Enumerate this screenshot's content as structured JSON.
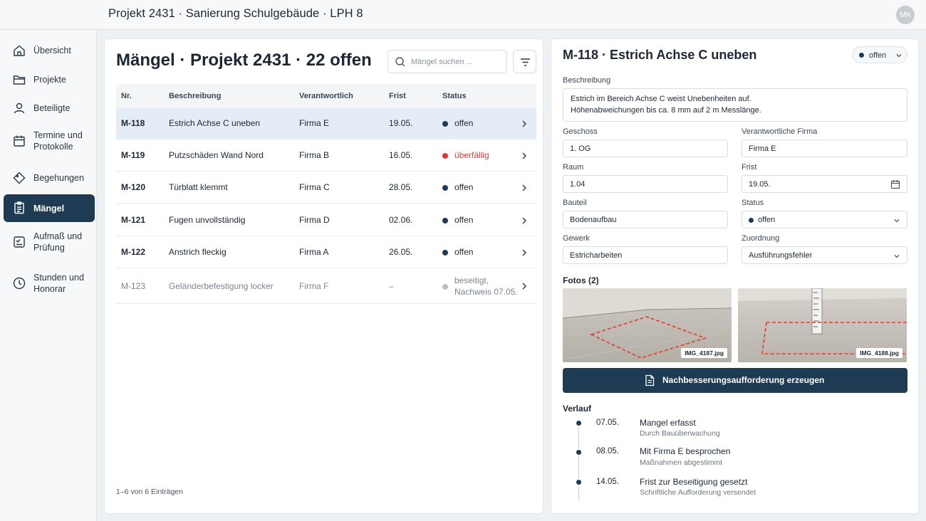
{
  "header": {
    "title": "Projekt 2431 · Sanierung Schulgebäude · LPH 8",
    "avatar_initials": "MK"
  },
  "sidebar": {
    "items": [
      {
        "label": "Übersicht",
        "icon": "home-icon"
      },
      {
        "label": "Projekte",
        "icon": "folder-icon"
      },
      {
        "label": "Beteiligte",
        "icon": "user-icon"
      },
      {
        "label": "Termine und Protokolle",
        "icon": "calendar-icon"
      },
      {
        "label": "Begehungen",
        "icon": "diamond-icon"
      },
      {
        "label": "Mängel",
        "icon": "clipboard-icon",
        "active": true
      },
      {
        "label": "Aufmaß und Prüfung",
        "icon": "checklist-icon"
      },
      {
        "label": "Stunden und Honorar",
        "icon": "clock-icon"
      }
    ]
  },
  "list": {
    "title": "Mängel · Projekt 2431 · 22 offen",
    "search_placeholder": "Mängel suchen ...",
    "columns": [
      "Nr.",
      "Beschreibung",
      "Verantwortlich",
      "Frist",
      "Status"
    ],
    "rows": [
      {
        "nr": "M-118",
        "desc": "Estrich Achse C uneben",
        "firm": "Firma E",
        "due": "19.05.",
        "status": "offen",
        "status_color": "#1f3b53"
      },
      {
        "nr": "M-119",
        "desc": "Putzschäden Wand Nord",
        "firm": "Firma B",
        "due": "16.05.",
        "status": "überfällig",
        "status_color": "#d63b3b"
      },
      {
        "nr": "M-120",
        "desc": "Türblatt klemmt",
        "firm": "Firma C",
        "due": "28.05.",
        "status": "offen",
        "status_color": "#1f3b53"
      },
      {
        "nr": "M-121",
        "desc": "Fugen unvollständig",
        "firm": "Firma D",
        "due": "02.06.",
        "status": "offen",
        "status_color": "#1f3b53"
      },
      {
        "nr": "M-122",
        "desc": "Anstrich fleckig",
        "firm": "Firma A",
        "due": "26.05.",
        "status": "offen",
        "status_color": "#1f3b53"
      },
      {
        "nr": "M-123",
        "desc": "Geländerbefestigung locker",
        "firm": "Firma F",
        "due": "–",
        "status": "beseitigt,",
        "status2": "Nachweis 07.05.",
        "status_color": "#b9bfc6"
      }
    ],
    "footer": "1–6 von 6 Einträgen"
  },
  "detail": {
    "title": "M-118 · Estrich Achse C uneben",
    "status": "offen",
    "description_label": "Beschreibung",
    "description_line1": "Estrich im Bereich Achse C weist Unebenheiten auf.",
    "description_line2": "Höhenabweichungen bis ca. 8 mm auf 2 m Messlänge.",
    "geschoss_label": "Geschoss",
    "geschoss": "1. OG",
    "firma_label": "Verantwortliche Firma",
    "firma": "Firma E",
    "raum_label": "Raum",
    "raum": "1.04",
    "frist_label": "Frist",
    "frist": "19.05.",
    "bauteil_label": "Bauteil",
    "bauteil": "Bodenaufbau",
    "status_label": "Status",
    "status_value": "offen",
    "gewerk_label": "Gewerk",
    "gewerk": "Estricharbeiten",
    "zuordnung_label": "Zuordnung",
    "zuordnung": "Ausführungsfehler",
    "photos_label": "Fotos (2)",
    "photos": [
      "IMG_4187.jpg",
      "IMG_4188.jpg"
    ],
    "action_button": "Nachbesserungsaufforderung erzeugen",
    "history_label": "Verlauf",
    "history": [
      {
        "date": "07.05.",
        "title": "Mangel erfasst",
        "sub": "Durch Bauüberwachung"
      },
      {
        "date": "08.05.",
        "title": "Mit Firma E besprochen",
        "sub": "Maßnahmen abgestimmt"
      },
      {
        "date": "14.05.",
        "title": "Frist zur Beseitigung gesetzt",
        "sub": "Schriftliche Aufforderung versendet"
      }
    ]
  }
}
